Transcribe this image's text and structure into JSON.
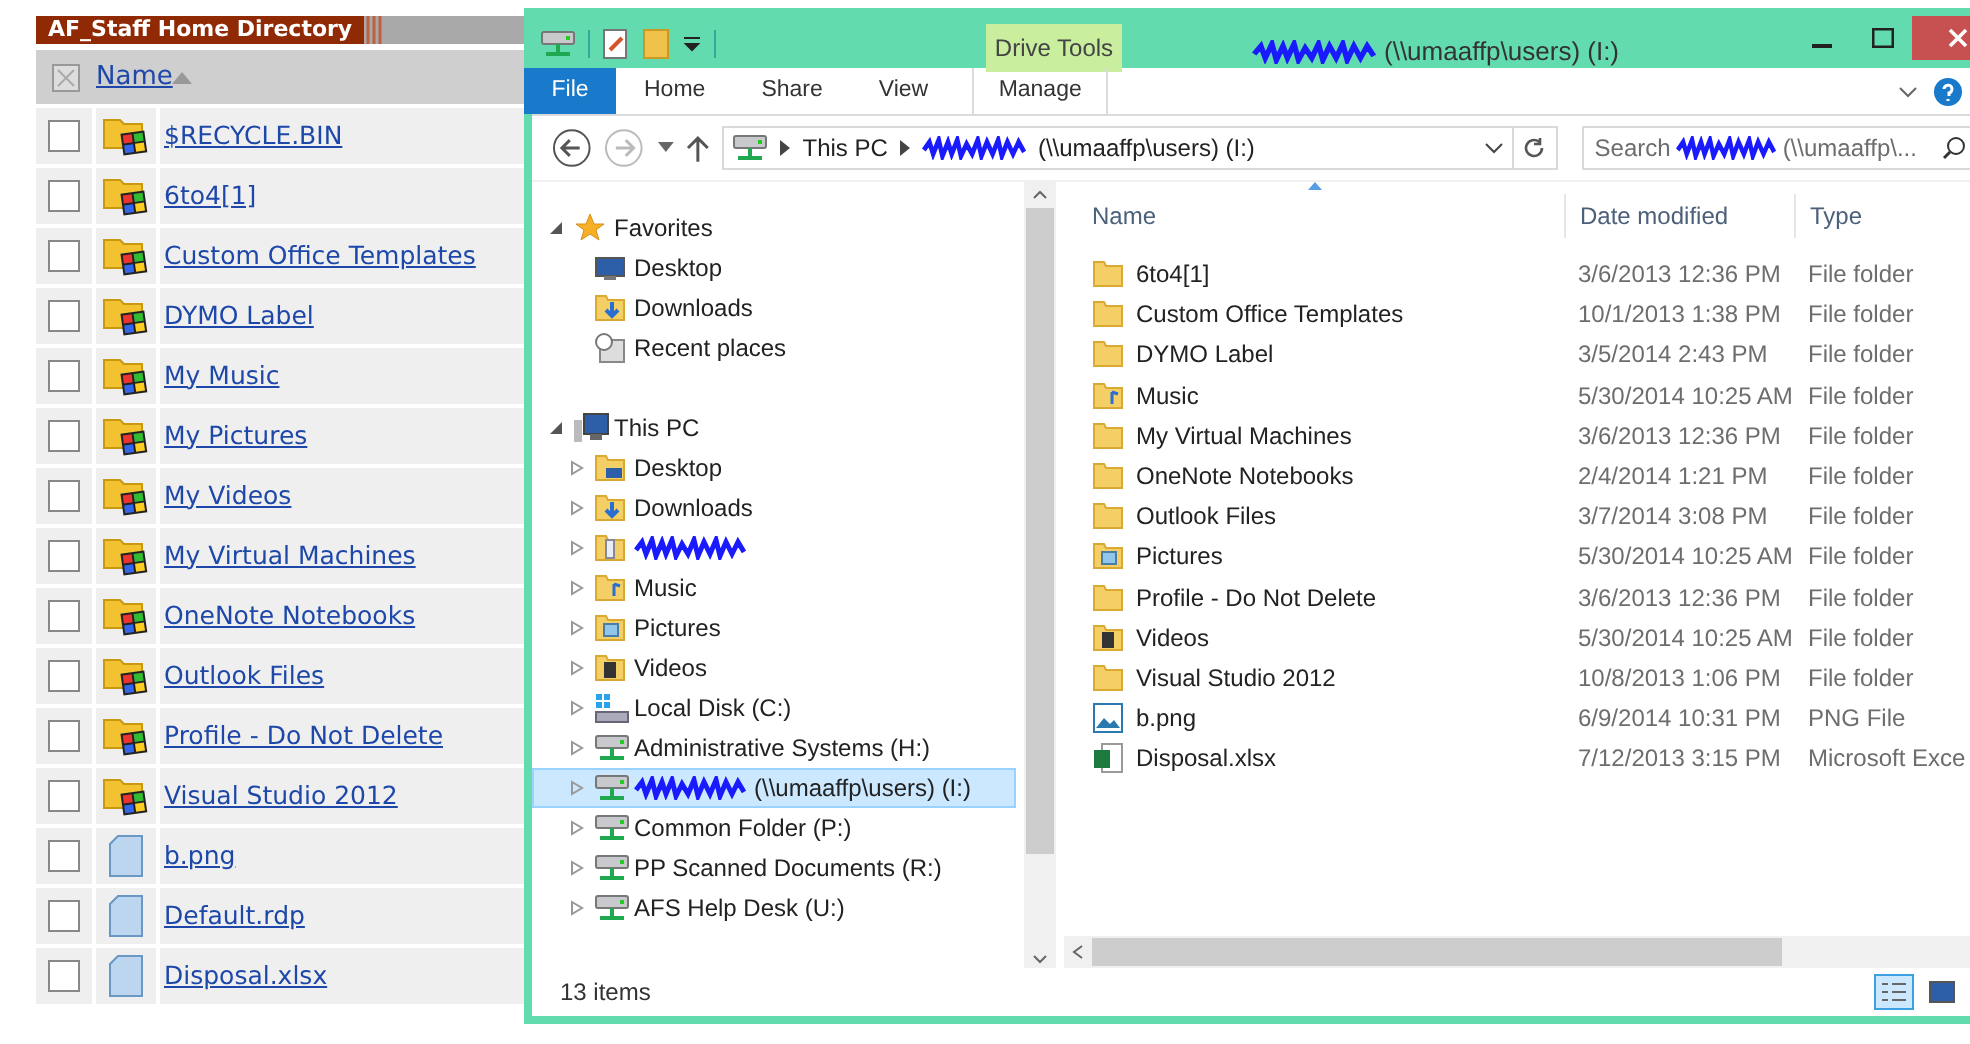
{
  "web_panel": {
    "title": "AF_Staff Home Directory",
    "column": {
      "label": "Name",
      "sorted": true
    },
    "rows": [
      {
        "name": "$RECYCLE.BIN",
        "kind": "folder",
        "checked": false
      },
      {
        "name": "6to4[1]",
        "kind": "folder",
        "checked": false
      },
      {
        "name": "Custom Office Templates",
        "kind": "folder",
        "checked": false
      },
      {
        "name": "DYMO Label",
        "kind": "folder",
        "checked": false
      },
      {
        "name": "My Music",
        "kind": "folder",
        "checked": false
      },
      {
        "name": "My Pictures",
        "kind": "folder",
        "checked": false
      },
      {
        "name": "My Videos",
        "kind": "folder",
        "checked": false
      },
      {
        "name": "My Virtual Machines",
        "kind": "folder",
        "checked": false
      },
      {
        "name": "OneNote Notebooks",
        "kind": "folder",
        "checked": false
      },
      {
        "name": "Outlook Files",
        "kind": "folder",
        "checked": false
      },
      {
        "name": "Profile - Do Not Delete",
        "kind": "folder",
        "checked": false
      },
      {
        "name": "Visual Studio 2012",
        "kind": "folder",
        "checked": false
      },
      {
        "name": "b.png",
        "kind": "file",
        "checked": false
      },
      {
        "name": "Default.rdp",
        "kind": "file",
        "checked": false
      },
      {
        "name": "Disposal.xlsx",
        "kind": "file",
        "checked": false
      }
    ]
  },
  "explorer": {
    "title": "(\\\\umaaffp\\users) (I:)",
    "title_redacted": true,
    "contextual_tab": "Drive Tools",
    "ribbon_tabs": [
      {
        "label": "File",
        "kind": "file"
      },
      {
        "label": "Home",
        "kind": "normal"
      },
      {
        "label": "Share",
        "kind": "normal"
      },
      {
        "label": "View",
        "kind": "normal"
      },
      {
        "label": "Manage",
        "kind": "contextual"
      }
    ],
    "address": [
      {
        "label": "This PC",
        "redacted": false
      },
      {
        "label": "(\\\\umaaffp\\users) (I:)",
        "redacted": true
      }
    ],
    "search": {
      "label": "Search",
      "placeholder": "(\\\\umaaffp\\...",
      "redacted": true
    },
    "nav": [
      {
        "label": "Favorites",
        "kind": "star",
        "expanded": true,
        "children": [
          {
            "label": "Desktop",
            "kind": "desktop",
            "selected": false
          },
          {
            "label": "Downloads",
            "kind": "downloads",
            "selected": false
          },
          {
            "label": "Recent places",
            "kind": "recent",
            "selected": false
          }
        ]
      },
      {
        "label": "This PC",
        "kind": "pc",
        "expanded": true,
        "children": [
          {
            "label": "Desktop",
            "kind": "folder-desktop",
            "expanded": false,
            "selected": false
          },
          {
            "label": "Downloads",
            "kind": "downloads",
            "expanded": false,
            "selected": false
          },
          {
            "redacted": true,
            "kind": "folder-user",
            "expanded": false,
            "selected": false
          },
          {
            "label": "Music",
            "kind": "music",
            "expanded": false,
            "selected": false
          },
          {
            "label": "Pictures",
            "kind": "pictures",
            "expanded": false,
            "selected": false
          },
          {
            "label": "Videos",
            "kind": "videos",
            "expanded": false,
            "selected": false
          },
          {
            "label": "Local Disk (C:)",
            "kind": "disk",
            "expanded": false,
            "selected": false
          },
          {
            "label": "Administrative Systems (H:)",
            "kind": "network",
            "expanded": false,
            "selected": false
          },
          {
            "label": "(\\\\umaaffp\\users) (I:)",
            "redacted": true,
            "kind": "network",
            "expanded": false,
            "selected": true
          },
          {
            "label": "Common Folder (P:)",
            "kind": "network",
            "expanded": false,
            "selected": false
          },
          {
            "label": "PP Scanned Documents (R:)",
            "kind": "network",
            "expanded": false,
            "selected": false
          },
          {
            "label": "AFS Help Desk (U:)",
            "kind": "network",
            "expanded": false,
            "selected": false
          }
        ]
      }
    ],
    "columns": [
      {
        "label": "Name",
        "sorted": true
      },
      {
        "label": "Date modified",
        "sorted": false
      },
      {
        "label": "Type",
        "sorted": false
      }
    ],
    "files": [
      {
        "name": "6to4[1]",
        "date": "3/6/2013 12:36 PM",
        "type": "File folder",
        "kind": "folder"
      },
      {
        "name": "Custom Office Templates",
        "date": "10/1/2013 1:38 PM",
        "type": "File folder",
        "kind": "folder"
      },
      {
        "name": "DYMO Label",
        "date": "3/5/2014 2:43 PM",
        "type": "File folder",
        "kind": "folder"
      },
      {
        "name": "Music",
        "date": "5/30/2014 10:25 AM",
        "type": "File folder",
        "kind": "music"
      },
      {
        "name": "My Virtual Machines",
        "date": "3/6/2013 12:36 PM",
        "type": "File folder",
        "kind": "folder"
      },
      {
        "name": "OneNote Notebooks",
        "date": "2/4/2014 1:21 PM",
        "type": "File folder",
        "kind": "folder"
      },
      {
        "name": "Outlook Files",
        "date": "3/7/2014 3:08 PM",
        "type": "File folder",
        "kind": "folder"
      },
      {
        "name": "Pictures",
        "date": "5/30/2014 10:25 AM",
        "type": "File folder",
        "kind": "pictures"
      },
      {
        "name": "Profile - Do Not Delete",
        "date": "3/6/2013 12:36 PM",
        "type": "File folder",
        "kind": "folder"
      },
      {
        "name": "Videos",
        "date": "5/30/2014 10:25 AM",
        "type": "File folder",
        "kind": "videos"
      },
      {
        "name": "Visual Studio 2012",
        "date": "10/8/2013 1:06 PM",
        "type": "File folder",
        "kind": "folder"
      },
      {
        "name": "b.png",
        "date": "6/9/2014 10:31 PM",
        "type": "PNG File",
        "kind": "image"
      },
      {
        "name": "Disposal.xlsx",
        "date": "7/12/2013 3:15 PM",
        "type": "Microsoft Exce",
        "kind": "excel"
      }
    ],
    "status": "13 items",
    "views": [
      {
        "kind": "details",
        "selected": true
      },
      {
        "kind": "large-icons",
        "selected": false
      }
    ]
  }
}
